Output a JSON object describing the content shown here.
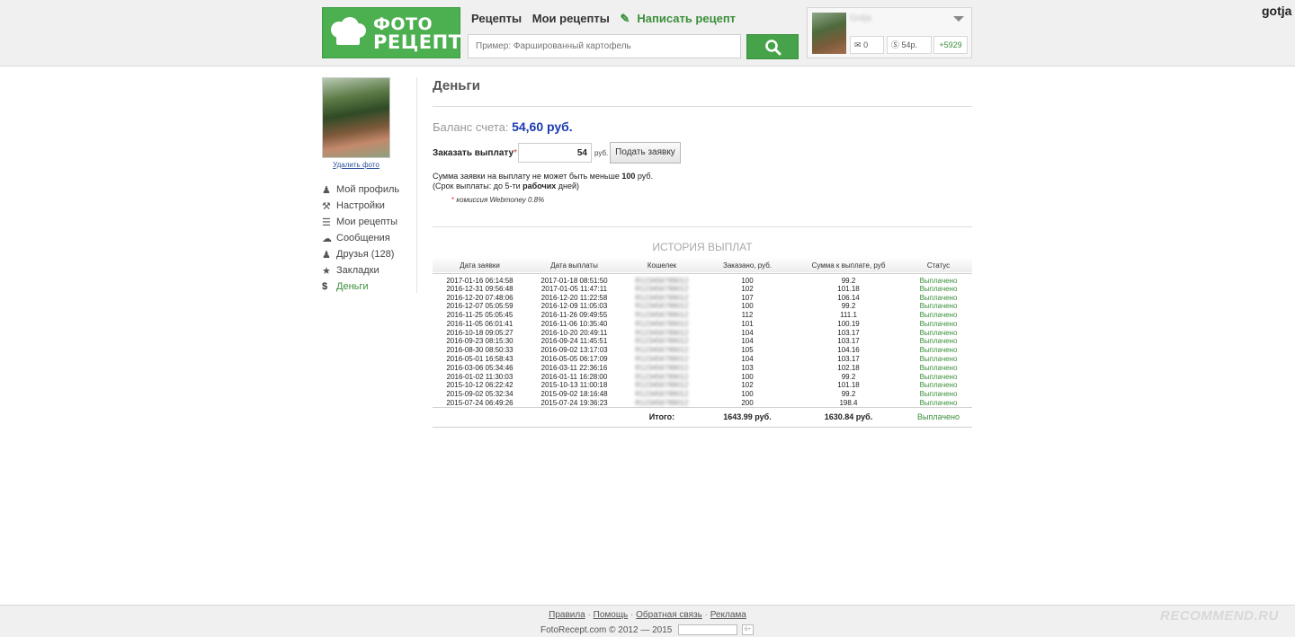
{
  "header": {
    "logo_line1": "ФОТО",
    "logo_line2": "РЕЦЕПТ",
    "nav": {
      "recipes": "Рецепты",
      "my_recipes": "Мои рецепты",
      "write_recipe": "Написать рецепт"
    },
    "search": {
      "placeholder": "Пример: Фаршированный картофель"
    },
    "user": {
      "name": "Gotja",
      "messages": "0",
      "balance": "54р.",
      "rating": "+5929"
    },
    "corner_username": "gotja"
  },
  "sidebar": {
    "delete_photo": "Удалить фото",
    "items": [
      {
        "label": "Мой профиль",
        "icon": "person-icon"
      },
      {
        "label": "Настройки",
        "icon": "wrench-icon"
      },
      {
        "label": "Мои рецепты",
        "icon": "recipes-icon"
      },
      {
        "label": "Сообщения",
        "icon": "chat-icon"
      },
      {
        "label": "Друзья (128)",
        "icon": "friends-icon"
      },
      {
        "label": "Закладки",
        "icon": "star-icon"
      },
      {
        "label": "Деньги",
        "icon": "dollar-icon",
        "active": true
      }
    ]
  },
  "main": {
    "title": "Деньги",
    "balance_label": "Баланс счета:",
    "balance_value": "54,60 руб.",
    "order_label": "Заказать выплату",
    "order_required": "*",
    "order_colon": ":",
    "order_value": "54",
    "order_unit": "руб.",
    "submit_label": "Подать заявку",
    "note_line1_prefix": "Сумма заявки на выплату не может быть меньше",
    "note_line1_min": "100",
    "note_line1_suffix": "руб.",
    "note_line2_prefix": "(Срок выплаты: до 5-ти",
    "note_line2_bold": "рабочих",
    "note_line2_suffix": "дней)",
    "commission_star": "*",
    "commission_text": "комиссия Webmoney 0.8%",
    "history": {
      "title": "ИСТОРИЯ ВЫПЛАТ",
      "columns": [
        "Дата заявки",
        "Дата выплаты",
        "Кошелек",
        "Заказано, руб.",
        "Сумма к выплате, руб",
        "Статус"
      ],
      "rows": [
        [
          "2017-01-16 06:14:58",
          "2017-01-18 08:51:50",
          "R123456789012",
          "100",
          "99.2",
          "Выплачено"
        ],
        [
          "2016-12-31 09:56:48",
          "2017-01-05 11:47:11",
          "R123456789012",
          "102",
          "101.18",
          "Выплачено"
        ],
        [
          "2016-12-20 07:48:06",
          "2016-12-20 11:22:58",
          "R123456789012",
          "107",
          "106.14",
          "Выплачено"
        ],
        [
          "2016-12-07 05:05:59",
          "2016-12-09 11:05:03",
          "R123456789012",
          "100",
          "99.2",
          "Выплачено"
        ],
        [
          "2016-11-25 05:05:45",
          "2016-11-26 09:49:55",
          "R123456789012",
          "112",
          "111.1",
          "Выплачено"
        ],
        [
          "2016-11-05 06:01:41",
          "2016-11-06 10:35:40",
          "R123456789012",
          "101",
          "100.19",
          "Выплачено"
        ],
        [
          "2016-10-18 09:05:27",
          "2016-10-20 20:49:11",
          "R123456789012",
          "104",
          "103.17",
          "Выплачено"
        ],
        [
          "2016-09-23 08:15:30",
          "2016-09-24 11:45:51",
          "R123456789012",
          "104",
          "103.17",
          "Выплачено"
        ],
        [
          "2016-08-30 08:50:33",
          "2016-09-02 13:17:03",
          "R123456789012",
          "105",
          "104.16",
          "Выплачено"
        ],
        [
          "2016-05-01 16:58:43",
          "2016-05-05 06:17:09",
          "R123456789012",
          "104",
          "103.17",
          "Выплачено"
        ],
        [
          "2016-03-06 05:34:46",
          "2016-03-11 22:36:16",
          "R123456789012",
          "103",
          "102.18",
          "Выплачено"
        ],
        [
          "2016-01-02 11:30:03",
          "2016-01-11 16:28:00",
          "R123456789012",
          "100",
          "99.2",
          "Выплачено"
        ],
        [
          "2015-10-12 06:22:42",
          "2015-10-13 11:00:18",
          "R123456789012",
          "102",
          "101.18",
          "Выплачено"
        ],
        [
          "2015-09-02 05:32:34",
          "2015-09-02 18:16:48",
          "R123456789012",
          "100",
          "99.2",
          "Выплачено"
        ],
        [
          "2015-07-24 06:49:26",
          "2015-07-24 19:36:23",
          "R123456789012",
          "200",
          "198.4",
          "Выплачено"
        ]
      ],
      "total": {
        "label": "Итого:",
        "ordered": "1643.99 руб.",
        "payout": "1630.84 руб.",
        "status": "Выплачено"
      }
    }
  },
  "footer": {
    "links": [
      "Правила",
      "Помощь",
      "Обратная связь",
      "Реклама"
    ],
    "copyright": "FotoRecept.com © 2012 — 2015",
    "badge": "6+"
  },
  "watermark": "RECOMMEND.RU",
  "colors": {
    "brand_green": "#4caf50",
    "link_blue": "#2b4f9e",
    "balance_blue": "#1b3bb0",
    "status_green": "#3a8f3a"
  }
}
